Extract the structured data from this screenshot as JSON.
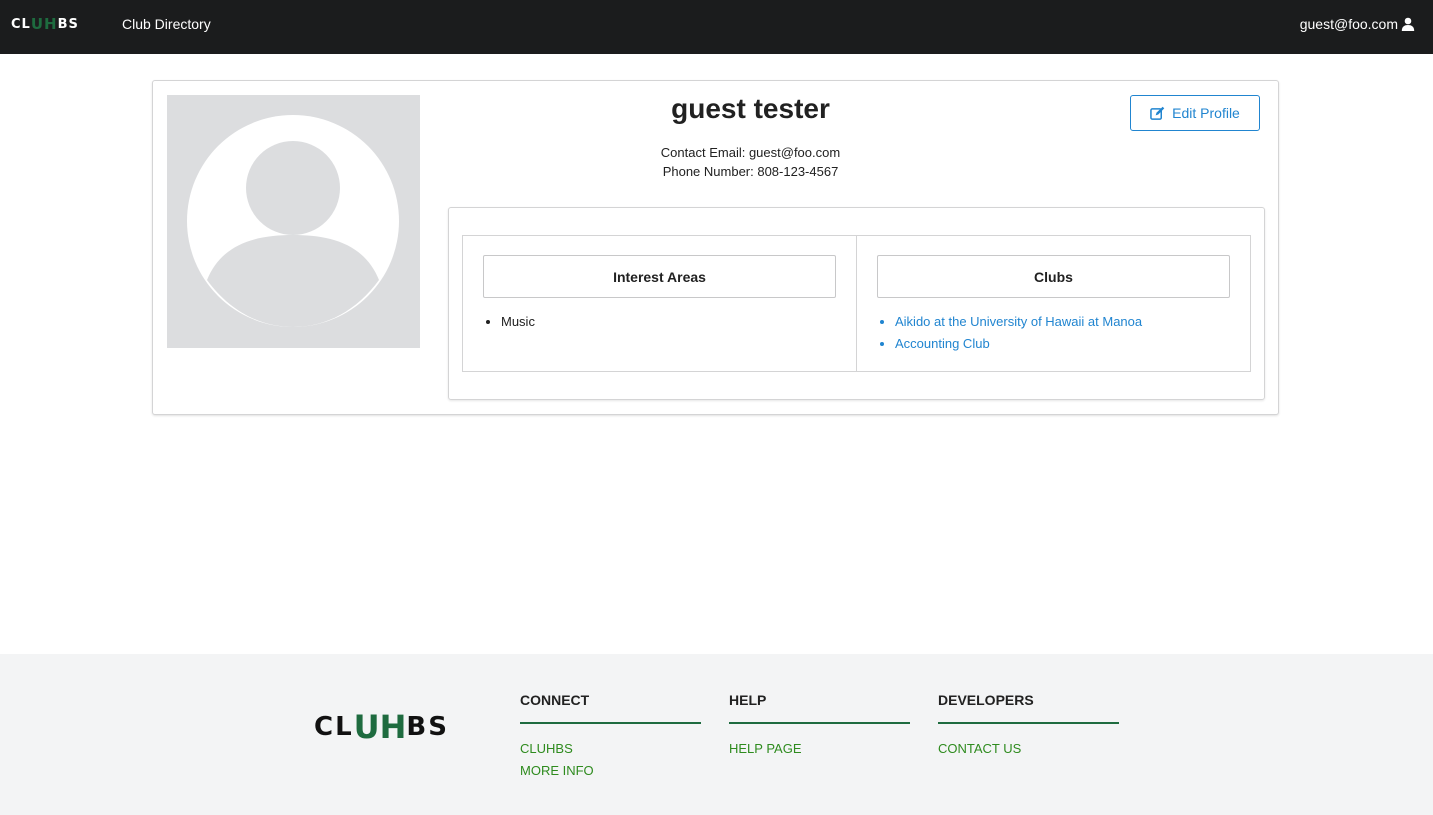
{
  "navbar": {
    "logo_text_left": "CL",
    "logo_text_mid": "UH",
    "logo_text_right": "BS",
    "directory_link": "Club Directory",
    "user_email": "guest@foo.com"
  },
  "profile": {
    "name": "guest tester",
    "edit_button": "Edit Profile",
    "contact_email_line": "Contact Email: guest@foo.com",
    "phone_line": "Phone Number: 808-123-4567",
    "interest_areas_header": "Interest Areas",
    "interests": [
      "Music"
    ],
    "clubs_header": "Clubs",
    "clubs": [
      "Aikido at the University of Hawaii at Manoa",
      "Accounting Club"
    ]
  },
  "footer": {
    "logo_text_left": "CL",
    "logo_text_mid": "UH",
    "logo_text_right": "BS",
    "connect": {
      "title": "CONNECT",
      "links": [
        "CLUHBS",
        "MORE INFO"
      ]
    },
    "help": {
      "title": "HELP",
      "links": [
        "HELP PAGE"
      ]
    },
    "developers": {
      "title": "DEVELOPERS",
      "links": [
        "CONTACT US"
      ]
    }
  },
  "colors": {
    "navbar_bg": "#1b1c1d",
    "link_blue": "#2185d0",
    "uh_green": "#1e6b3f",
    "footer_link_green": "#2e8b1e",
    "footer_bg": "#f3f4f5"
  },
  "icons": {
    "user": "user-icon",
    "edit": "edit-icon",
    "avatar": "avatar-placeholder-icon"
  }
}
